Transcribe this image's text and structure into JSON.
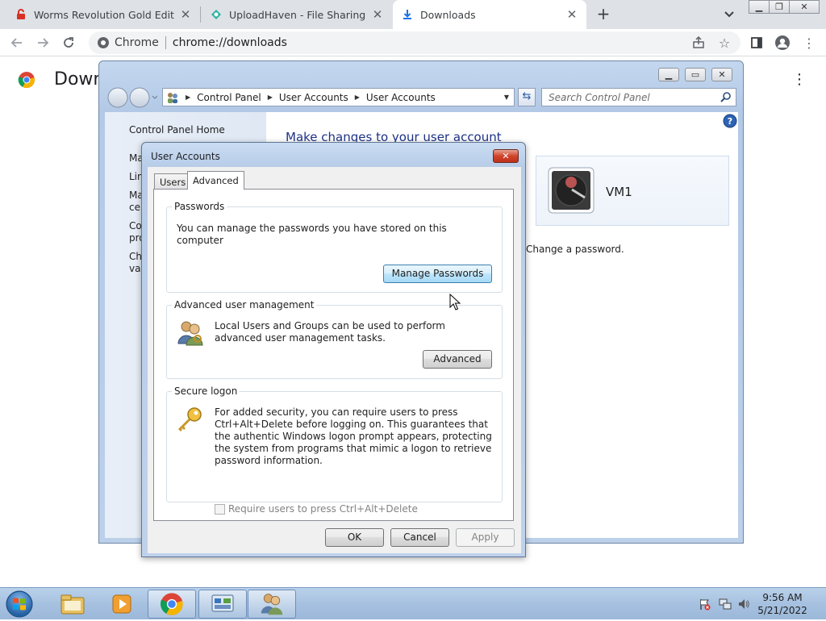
{
  "browser": {
    "tabs": [
      {
        "title": "Worms Revolution Gold Edition F",
        "active": false
      },
      {
        "title": "UploadHaven - File Sharing Made",
        "active": false
      },
      {
        "title": "Downloads",
        "active": true
      }
    ],
    "omnibox_chip": "Chrome",
    "url": "chrome://downloads"
  },
  "downloads_page": {
    "title": "Down"
  },
  "control_panel": {
    "breadcrumb": [
      "Control Panel",
      "User Accounts",
      "User Accounts"
    ],
    "search_placeholder": "Search Control Panel",
    "left_home": "Control Panel Home",
    "left_items": [
      "Ma",
      "Lin",
      "Ma cer",
      "Co pro",
      "Ch var"
    ],
    "heading": "Make changes to your user account",
    "username": "VM1",
    "change_password": "Change a password."
  },
  "dialog": {
    "title": "User Accounts",
    "tabs": {
      "users": "Users",
      "advanced": "Advanced"
    },
    "passwords": {
      "label": "Passwords",
      "text": "You can manage the passwords you have stored on this computer",
      "button": "Manage Passwords"
    },
    "advanced_mgmt": {
      "label": "Advanced user management",
      "text": "Local Users and Groups can be used to perform advanced user management tasks.",
      "button": "Advanced"
    },
    "secure_logon": {
      "label": "Secure logon",
      "text": "For added security, you can require users to press Ctrl+Alt+Delete before logging on. This guarantees that the authentic Windows logon prompt appears, protecting the system from programs that mimic a logon to retrieve password information.",
      "checkbox": "Require users to press Ctrl+Alt+Delete",
      "checked": false
    },
    "buttons": {
      "ok": "OK",
      "cancel": "Cancel",
      "apply": "Apply"
    }
  },
  "taskbar": {
    "time": "9:56 AM",
    "date": "5/21/2022"
  },
  "colors": {
    "chrome_frame": "#dee1e6",
    "cp_heading": "#1e3287",
    "taskbar": "#a6c1e0"
  }
}
